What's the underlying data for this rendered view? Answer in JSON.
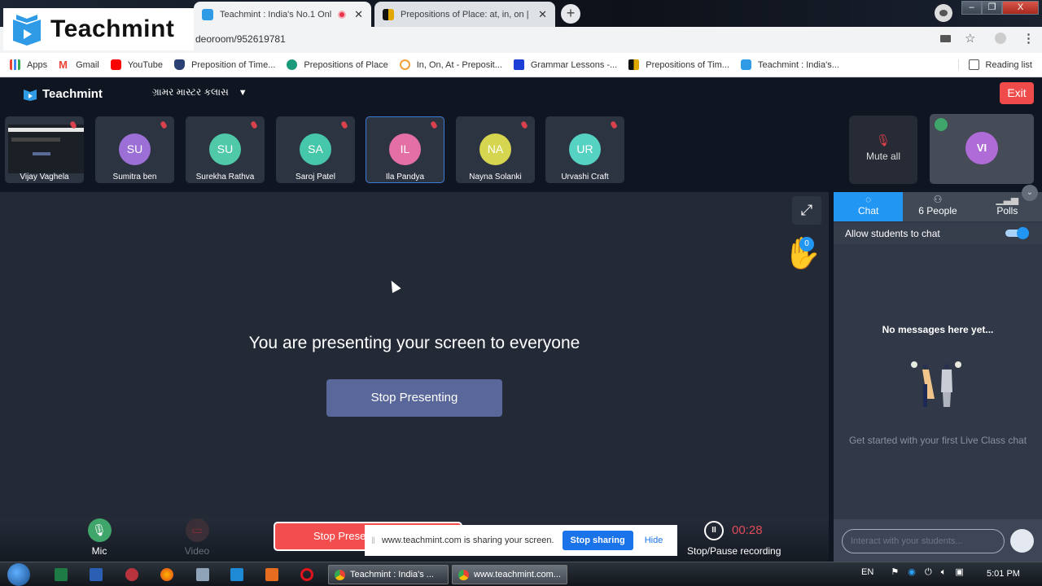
{
  "browser": {
    "tabs": [
      {
        "title": "Teachmint : India's No.1 Onl",
        "recording": true,
        "active": true
      },
      {
        "title": "Prepositions of Place: at, in, on |",
        "active": false
      }
    ],
    "new_tab_label": "+",
    "url": "deoroom/952619781",
    "window_controls": {
      "minimize": "–",
      "restore": "❐",
      "close": "X"
    },
    "bookmarks": [
      {
        "label": "Apps",
        "icon": "apps-grid-icon",
        "color": "#4285f4"
      },
      {
        "label": "Gmail",
        "icon": "gmail-icon",
        "color": "#ea4335"
      },
      {
        "label": "YouTube",
        "icon": "youtube-icon",
        "color": "#ff0000"
      },
      {
        "label": "Preposition of Time...",
        "icon": "shield-icon",
        "color": "#2a3f73"
      },
      {
        "label": "Prepositions of Place",
        "icon": "p-circle-icon",
        "color": "#1a9a7a"
      },
      {
        "label": "In, On, At - Preposit...",
        "icon": "ec-icon",
        "color": "#f2a03a"
      },
      {
        "label": "Grammar Lessons -...",
        "icon": "f-icon",
        "color": "#1c3fd6"
      },
      {
        "label": "Prepositions of Tim...",
        "icon": "black-yellow-icon",
        "color": "#e0a800"
      },
      {
        "label": "Teachmint : India's...",
        "icon": "teachmint-icon",
        "color": "#2f9be6"
      }
    ],
    "reading_list": "Reading list"
  },
  "overlay_logo": "Teachmint",
  "app": {
    "logo": "Teachmint",
    "class_name": "ગ્રામર માસ્ટર કલાસ",
    "exit_label": "Exit",
    "participants": [
      {
        "initials": "",
        "name": "Vijay Vaghela",
        "screen": true
      },
      {
        "initials": "SU",
        "name": "Sumitra ben",
        "color": "#9b6fd6"
      },
      {
        "initials": "SU",
        "name": "Surekha Rathva",
        "color": "#4fc9a8"
      },
      {
        "initials": "SA",
        "name": "Saroj Patel",
        "color": "#47c7a9"
      },
      {
        "initials": "IL",
        "name": "Ila Pandya",
        "color": "#e46fa5"
      },
      {
        "initials": "NA",
        "name": "Nayna Solanki",
        "color": "#d5d54f"
      },
      {
        "initials": "UR",
        "name": "Urvashi Craft",
        "color": "#56d2c3"
      }
    ],
    "mute_all_label": "Mute all",
    "self_tile": {
      "initials": "VI"
    },
    "stage": {
      "message": "You are presenting your screen to everyone",
      "stop_presenting": "Stop Presenting",
      "raised_hands": "0"
    },
    "panel": {
      "tabs": [
        {
          "label": "Chat",
          "icon": "chat-icon",
          "active": true
        },
        {
          "label": "6 People",
          "icon": "people-icon",
          "active": false
        },
        {
          "label": "Polls",
          "icon": "polls-icon",
          "active": false
        }
      ],
      "allow_chat_label": "Allow students to chat",
      "allow_chat_enabled": true,
      "empty_title": "No messages here yet...",
      "empty_subtitle": "Get started with your first Live Class chat",
      "input_placeholder": "Interact with your students..."
    },
    "controls": {
      "mic_label": "Mic",
      "video_label": "Video",
      "stop_presenting_short": "Stop Prese",
      "share_notice": "www.teachmint.com is sharing your screen.",
      "stop_sharing": "Stop sharing",
      "hide": "Hide",
      "recording_time": "00:28",
      "recording_label": "Stop/Pause recording"
    }
  },
  "taskbar": {
    "tasks": [
      "Teachmint : India's ...",
      "www.teachmint.com..."
    ],
    "language": "EN",
    "clock": "5:01 PM"
  }
}
